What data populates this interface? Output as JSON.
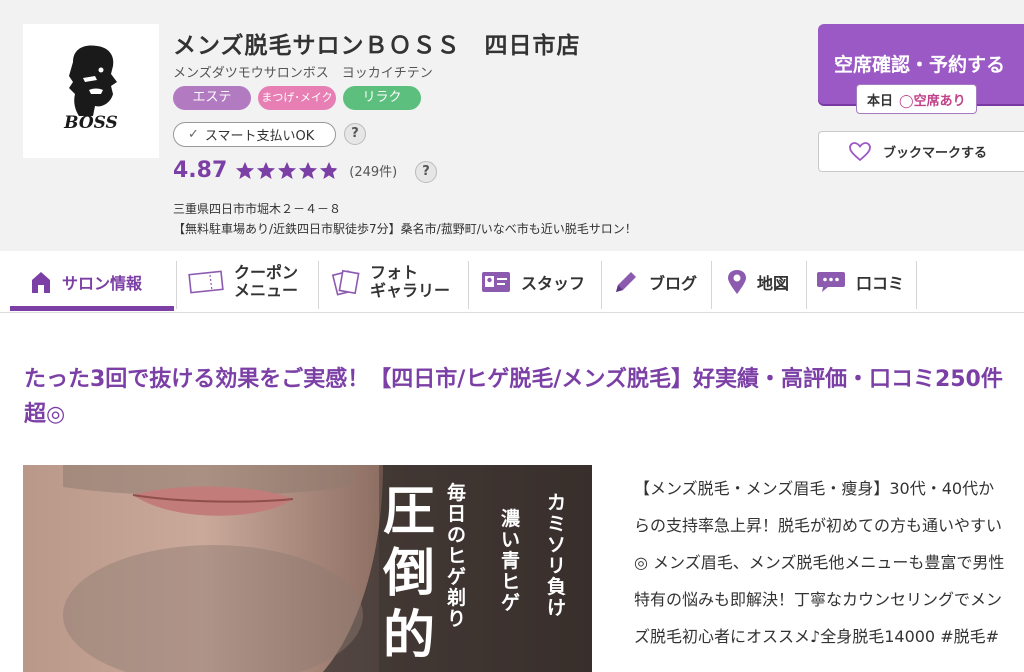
{
  "salon": {
    "name": "メンズ脱毛サロンＢＯＳＳ　四日市店",
    "kana": "メンズダツモウサロンボス　ヨッカイチテン",
    "logo_text": "BOSS",
    "tags": [
      "エステ",
      "まつげ･メイク",
      "リラク"
    ],
    "smart_pay": "スマート支払いOK",
    "help": "?",
    "rating": "4.87",
    "stars_value": 4.87,
    "review_count": "(249件)",
    "address": "三重県四日市市堀木２－４－８",
    "catch": "【無料駐車場あり/近鉄四日市駅徒歩7分】桑名市/菰野町/いなべ市も近い脱毛サロン！"
  },
  "actions": {
    "reserve": "空席確認・予約する",
    "today_label": "本日",
    "availability": "◯空席あり",
    "bookmark": "ブックマークする"
  },
  "nav": {
    "salon_info": "サロン情報",
    "coupon_line1": "クーポン",
    "coupon_line2": "メニュー",
    "photo_line1": "フォト",
    "photo_line2": "ギャラリー",
    "staff": "スタッフ",
    "blog": "ブログ",
    "map": "地図",
    "reviews": "口コミ"
  },
  "content": {
    "headline": "たった3回で抜ける効果をご実感！【四日市/ヒゲ脱毛/メンズ脱毛】好実績・高評価・口コミ250件超◎",
    "photo_text": {
      "col1": "カミソリ負け",
      "col2": "濃い青ヒゲ",
      "col3": "毎日のヒゲ剃り",
      "big": "圧倒的"
    },
    "body": "【メンズ脱毛・メンズ眉毛・痩身】30代・40代からの支持率急上昇！脱毛が初めての方も通いやすい◎ メンズ眉毛、メンズ脱毛他メニューも豊富で男性特有の悩みも即解決！丁寧なカウンセリングでメンズ脱毛初心者にオススメ♪全身脱毛14000 #脱毛#"
  },
  "colors": {
    "brand_purple": "#7b3fa6",
    "reserve_button": "#9b59c6",
    "tag_este": "#b27ac0",
    "tag_matsuge": "#e77fb5",
    "tag_relax": "#5cbf7e",
    "availability": "#c0438a",
    "header_bg": "#f2f2f2"
  }
}
